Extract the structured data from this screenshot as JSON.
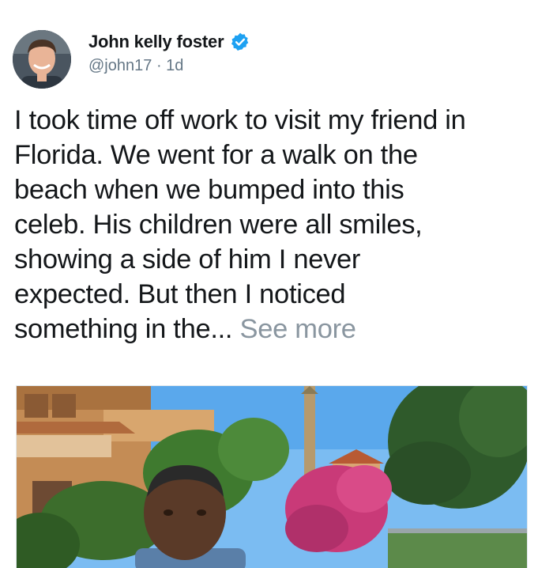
{
  "author": {
    "display_name": "John kelly foster",
    "handle": "@john17",
    "separator": "·",
    "time_ago": "1d",
    "verified_icon": "verified-badge-icon",
    "avatar_icon": "profile-photo"
  },
  "tweet": {
    "lines": [
      "I took time off work to visit my friend in",
      "Florida. We went for a walk on the",
      "beach when we bumped into this",
      "celeb. His children were all smiles,",
      "showing a side of him I never",
      "expected. But then I noticed"
    ],
    "last_line_text": "something in the...",
    "see_more_label": "See more"
  },
  "media": {
    "description_icon": "photo-of-man-in-garden"
  },
  "colors": {
    "text": "#14171a",
    "secondary": "#657786",
    "link_gray": "#8a96a0",
    "verified_blue": "#1da1f2"
  }
}
